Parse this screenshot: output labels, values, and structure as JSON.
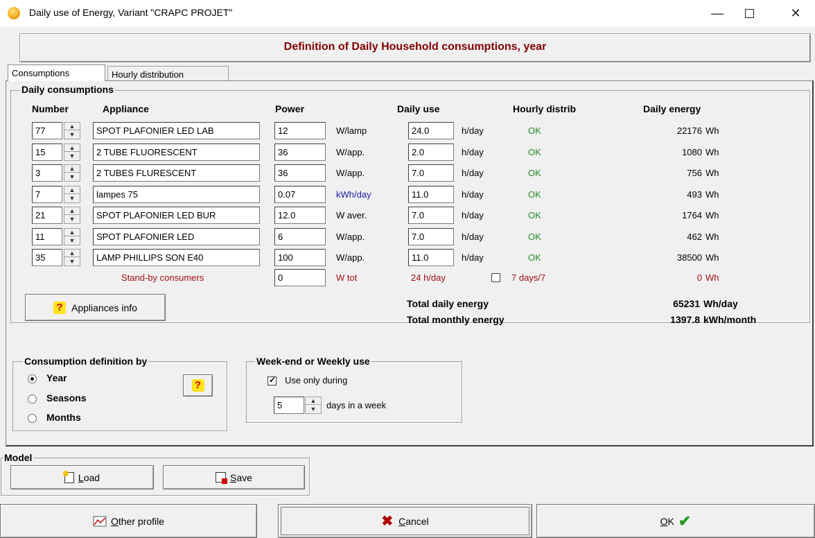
{
  "window": {
    "title": "Daily use of Energy, Variant  \"CRAPC PROJET\""
  },
  "header": {
    "title": "Definition of Daily Household consumptions, year"
  },
  "tabs": [
    {
      "label": "Consumptions"
    },
    {
      "label": "Hourly distribution"
    }
  ],
  "daily": {
    "group_title": "Daily consumptions",
    "headers": {
      "number": "Number",
      "appliance": "Appliance",
      "power": "Power",
      "daily_use": "Daily use",
      "hourly": "Hourly distrib",
      "energy": "Daily energy"
    },
    "rows": [
      {
        "number": "77",
        "appliance": "SPOT PLAFONIER LED LAB",
        "power": "12",
        "unit": "W/lamp",
        "daily_use": "24.0",
        "use_unit": "h/day",
        "hourly": "OK",
        "energy": "22176",
        "energy_unit": "Wh"
      },
      {
        "number": "15",
        "appliance": "2 TUBE  FLUORESCENT",
        "power": "36",
        "unit": "W/app.",
        "daily_use": "2.0",
        "use_unit": "h/day",
        "hourly": "OK",
        "energy": "1080",
        "energy_unit": "Wh"
      },
      {
        "number": "3",
        "appliance": "2 TUBES FLURESCENT",
        "power": "36",
        "unit": "W/app.",
        "daily_use": "7.0",
        "use_unit": "h/day",
        "hourly": "OK",
        "energy": "756",
        "energy_unit": "Wh"
      },
      {
        "number": "7",
        "appliance": "lampes 75",
        "power": "0.07",
        "unit": "kWh/day",
        "daily_use": "11.0",
        "use_unit": "h/day",
        "hourly": "OK",
        "energy": "493",
        "energy_unit": "Wh"
      },
      {
        "number": "21",
        "appliance": "SPOT PLAFONIER LED BUR",
        "power": "12.0",
        "unit": "W aver.",
        "daily_use": "7.0",
        "use_unit": "h/day",
        "hourly": "OK",
        "energy": "1764",
        "energy_unit": "Wh"
      },
      {
        "number": "11",
        "appliance": "SPOT PLAFONIER LED",
        "power": "6",
        "unit": "W/app.",
        "daily_use": "7.0",
        "use_unit": "h/day",
        "hourly": "OK",
        "energy": "462",
        "energy_unit": "Wh"
      },
      {
        "number": "35",
        "appliance": "LAMP PHILLIPS SON E40",
        "power": "100",
        "unit": "W/app.",
        "daily_use": "11.0",
        "use_unit": "h/day",
        "hourly": "OK",
        "energy": "38500",
        "energy_unit": "Wh"
      }
    ],
    "standby": {
      "label": "Stand-by consumers",
      "power": "0",
      "unit": "W tot",
      "use": "24 h/day",
      "seven_days_label": "7 days/7",
      "seven_days_checked": false,
      "energy": "0",
      "energy_unit": "Wh"
    },
    "appliances_info_label": "Appliances info",
    "totals": {
      "daily_label": "Total daily energy",
      "daily_value": "65231",
      "daily_unit": "Wh/day",
      "monthly_label": "Total monthly energy",
      "monthly_value": "1397.8",
      "monthly_unit": "kWh/month"
    }
  },
  "consumption_def": {
    "title": "Consumption definition by",
    "options": [
      {
        "label": "Year",
        "selected": true
      },
      {
        "label": "Seasons",
        "selected": false
      },
      {
        "label": "Months",
        "selected": false
      }
    ]
  },
  "weekend": {
    "title": "Week-end or Weekly use",
    "use_only_label": "Use only during",
    "use_only_checked": true,
    "days_value": "5",
    "days_label": "days in a week"
  },
  "model": {
    "title": "Model",
    "load_rest": "oad",
    "save_rest": "ave"
  },
  "footer": {
    "other_profile_rest": "ther profile",
    "cancel_rest": "ancel",
    "ok_rest": "K"
  },
  "colors": {
    "header_title": "#800000",
    "ok_status": "#228b22",
    "standby": "#a01010",
    "unit_blue": "#1a1aa6"
  },
  "icons": {
    "app": "sun-app-icon",
    "question": "question-icon",
    "load": "load-icon",
    "save": "save-icon",
    "profile": "chart-icon",
    "cancel": "x-icon",
    "ok": "check-icon"
  }
}
